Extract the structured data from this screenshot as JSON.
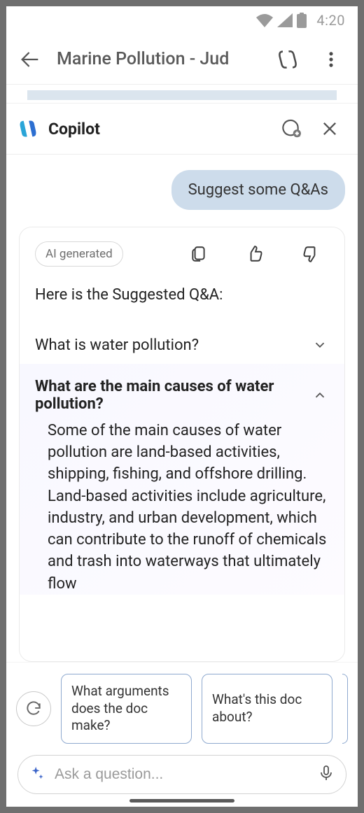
{
  "status": {
    "time": "4:20"
  },
  "header": {
    "title": "Marine Pollution - Jud"
  },
  "copilot": {
    "title": "Copilot"
  },
  "user_message": "Suggest some Q&As",
  "card": {
    "badge": "AI generated",
    "intro": "Here is the Suggested Q&A:",
    "qa": [
      {
        "question": "What is water pollution?",
        "expanded": false
      },
      {
        "question": "What are the main causes of water pollution?",
        "expanded": true,
        "answer": "Some of the main causes of water pollution are land-based activities, shipping, fishing, and offshore drilling. Land-based activities include agriculture, industry, and urban development, which can contribute to the runoff of chemicals and trash into waterways that ultimately flow"
      }
    ]
  },
  "suggestions": {
    "items": [
      "What arguments does the doc make?",
      "What's this doc about?"
    ]
  },
  "input": {
    "placeholder": "Ask a question..."
  }
}
